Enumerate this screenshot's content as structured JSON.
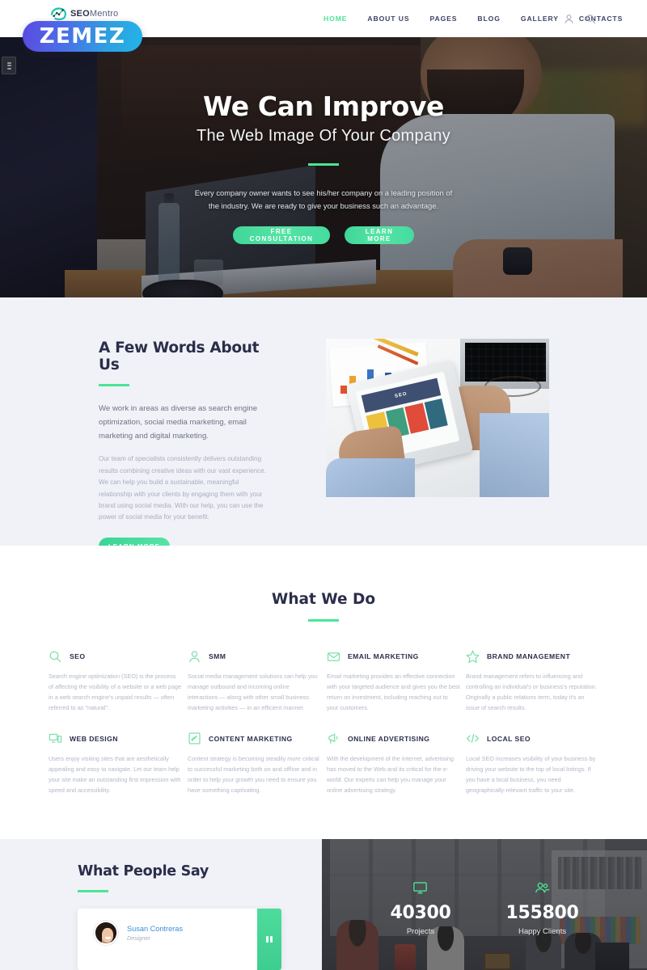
{
  "brand": {
    "logo_text": "SEO",
    "logo_subtext": "Mentro",
    "badge_label": "ZEMEZ",
    "accent_green": "#4be597",
    "accent_dark": "#2b2e4a",
    "badge_gradient_from": "#5b4ae0",
    "badge_gradient_to": "#23b4e8"
  },
  "nav": {
    "items": [
      {
        "label": "HOME",
        "active": true
      },
      {
        "label": "ABOUT US",
        "active": false
      },
      {
        "label": "PAGES",
        "active": false
      },
      {
        "label": "BLOG",
        "active": false
      },
      {
        "label": "GALLERY",
        "active": false
      },
      {
        "label": "CONTACTS",
        "active": false
      }
    ],
    "icons": [
      {
        "name": "user-account-icon"
      },
      {
        "name": "search-icon"
      }
    ]
  },
  "hero": {
    "title": "We Can Improve",
    "subtitle": "The Web Image Of Your Company",
    "text": "Every company owner wants to see his/her company on a leading position of the industry. We are ready to give your business such an advantage.",
    "primary_button": "FREE CONSULTATION",
    "secondary_button": "LEARN MORE"
  },
  "about": {
    "title": "A Few Words About Us",
    "lead": "We work in areas as diverse as search engine optimization, social media marketing, email marketing and digital marketing.",
    "body": "Our team of specialists consistently delivers outstanding results combining creative ideas with our vast experience. We can help you build a sustainable, meaningful relationship with your clients by engaging them with your brand using social media. With our help, you can use the power of social media for your benefit.",
    "button": "LEARN MORE",
    "image_screen_label": "SEO"
  },
  "services": {
    "title": "What We Do",
    "items": [
      {
        "icon": "magnifier-icon",
        "title": "SEO",
        "desc": "Search engine optimization (SEO) is the process of affecting the visibility of a website or a web page in a web search engine's unpaid results — often referred to as \"natural\"."
      },
      {
        "icon": "user-icon",
        "title": "SMM",
        "desc": "Social media management solutions can help you manage outbound and incoming online interactions — along with other small business marketing activities — in an efficient manner."
      },
      {
        "icon": "envelope-icon",
        "title": "EMAIL MARKETING",
        "desc": "Email marketing provides an effective connection with your targeted audience and gives you the best return on investment, including reaching out to your customers."
      },
      {
        "icon": "star-icon",
        "title": "BRAND MANAGEMENT",
        "desc": "Brand management refers to influencing and controlling an individual's or business's reputation. Originally a public relations term, today it's an issue of search results."
      },
      {
        "icon": "devices-icon",
        "title": "WEB DESIGN",
        "desc": "Users enjoy visiting sites that are aesthetically appealing and easy to navigate. Let our team help your site make an outstanding first impression with speed and accessibility."
      },
      {
        "icon": "pencil-square-icon",
        "title": "CONTENT MARKETING",
        "desc": "Content strategy is becoming steadily more critical to successful marketing both on and offline and in order to help your growth you need to ensure you have something captivating."
      },
      {
        "icon": "megaphone-icon",
        "title": "ONLINE ADVERTISING",
        "desc": "With the development of the Internet, advertising has moved to the Web and its critical for the e-world. Our experts can help you manage your online advertising strategy."
      },
      {
        "icon": "code-brackets-icon",
        "title": "LOCAL SEO",
        "desc": "Local SEO increases visibility of your business by driving your website to the top of local listings. If you have a local business, you need geographically-relevant traffic to your site."
      }
    ]
  },
  "testimonials": {
    "title": "What People Say",
    "items": [
      {
        "name": "Susan Contreras",
        "role": "Designer",
        "avatar": "woman-avatar"
      }
    ]
  },
  "counters": {
    "items": [
      {
        "icon": "monitor-icon",
        "value": "40300",
        "label": "Projects"
      },
      {
        "icon": "group-people-icon",
        "value": "155800",
        "label": "Happy Clients"
      }
    ]
  },
  "edge_tab": {
    "name": "panel-toggle-tab"
  }
}
